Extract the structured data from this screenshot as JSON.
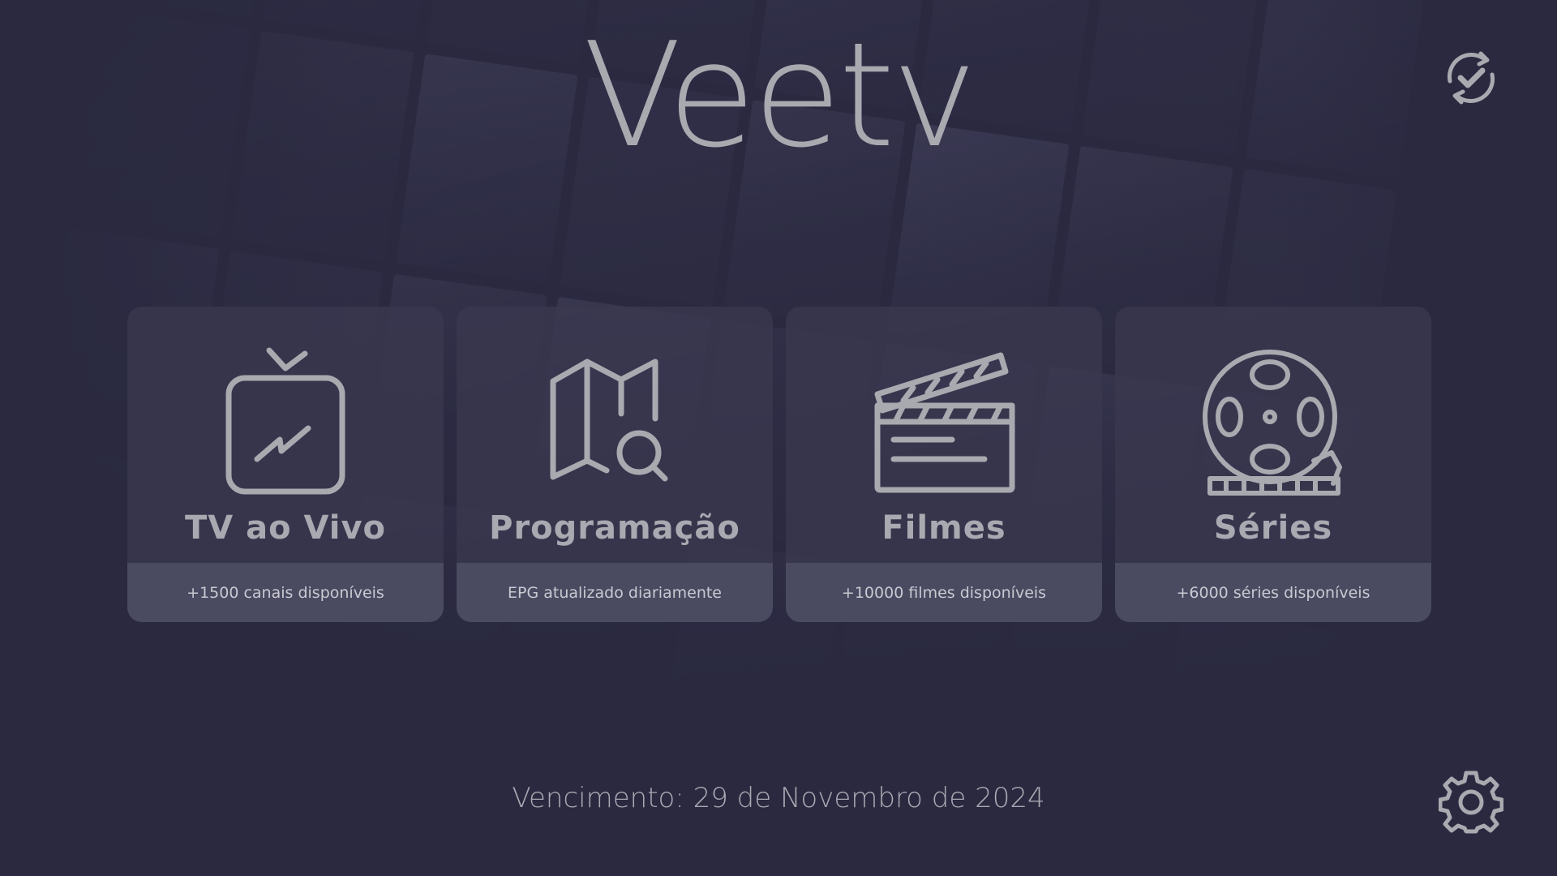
{
  "app": {
    "logo_text": "Veetv"
  },
  "icons": {
    "sync": "sync-check-icon",
    "settings": "gear-icon"
  },
  "cards": [
    {
      "icon": "tv-icon",
      "title": "TV ao Vivo",
      "subtitle": "+1500 canais disponíveis"
    },
    {
      "icon": "map-search-icon",
      "title": "Programação",
      "subtitle": "EPG atualizado diariamente"
    },
    {
      "icon": "clapperboard-icon",
      "title": "Filmes",
      "subtitle": "+10000 filmes disponíveis"
    },
    {
      "icon": "film-reel-icon",
      "title": "Séries",
      "subtitle": "+6000 séries disponíveis"
    }
  ],
  "footer": {
    "expiry_text": "Vencimento: 29 de Novembro de 2024"
  },
  "colors": {
    "background": "#2a2940",
    "card": "#3a3950",
    "card_footer": "#4e4d65",
    "icon": "#a9a9b0",
    "text": "#c9c9d2"
  }
}
